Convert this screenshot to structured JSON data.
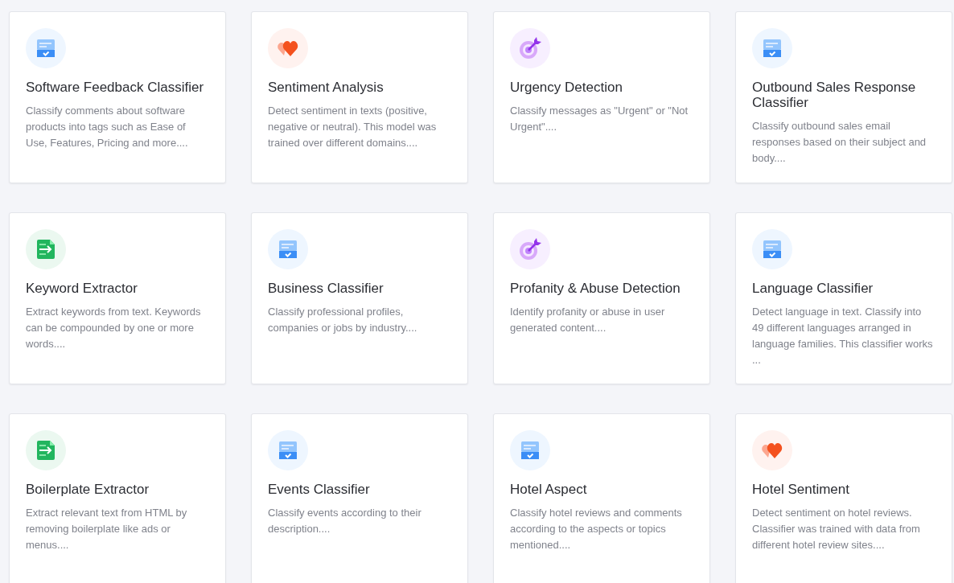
{
  "cards": [
    {
      "kind": "classifier",
      "title": "Software Feedback Classifier",
      "description": "Classify comments about software products into tags such as Ease of Use, Features, Pricing and more...."
    },
    {
      "kind": "sentiment",
      "title": "Sentiment Analysis",
      "description": "Detect sentiment in texts (positive, negative or neutral). This model was trained over different domains...."
    },
    {
      "kind": "target",
      "title": "Urgency Detection",
      "description": "Classify messages as \"Urgent\" or \"Not Urgent\"...."
    },
    {
      "kind": "classifier",
      "title": "Outbound Sales Response Classifier",
      "description": "Classify outbound sales email responses based on their subject and body...."
    },
    {
      "kind": "extractor",
      "title": "Keyword Extractor",
      "description": "Extract keywords from text. Keywords can be compounded by one or more words...."
    },
    {
      "kind": "classifier",
      "title": "Business Classifier",
      "description": "Classify professional profiles, companies or jobs by industry...."
    },
    {
      "kind": "target",
      "title": "Profanity & Abuse Detection",
      "description": "Identify profanity or abuse in user generated content...."
    },
    {
      "kind": "classifier",
      "title": "Language Classifier",
      "description": "Detect language in text. Classify into 49 different languages arranged in language families. This classifier works ..."
    },
    {
      "kind": "extractor",
      "title": "Boilerplate Extractor",
      "description": "Extract relevant text from HTML by removing boilerplate like ads or menus...."
    },
    {
      "kind": "classifier",
      "title": "Events Classifier",
      "description": "Classify events according to their description...."
    },
    {
      "kind": "classifier",
      "title": "Hotel Aspect",
      "description": "Classify hotel reviews and comments according to the aspects or topics mentioned...."
    },
    {
      "kind": "sentiment",
      "title": "Hotel Sentiment",
      "description": "Detect sentiment on hotel reviews. Classifier was trained with data from different hotel review sites...."
    }
  ]
}
